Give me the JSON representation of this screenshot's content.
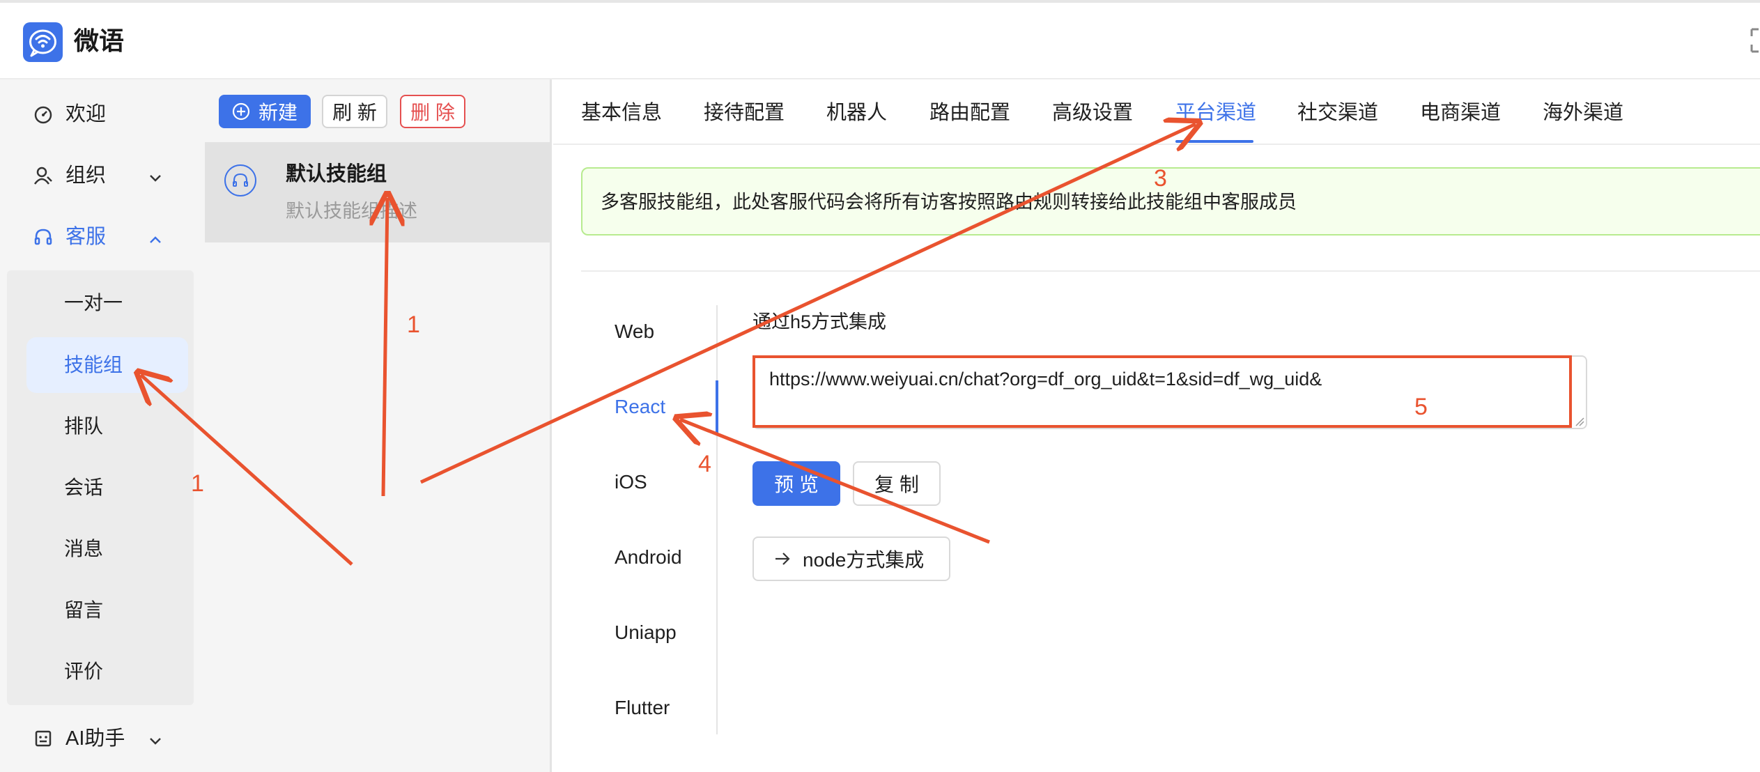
{
  "app": {
    "title": "微语",
    "logo_icon": "chat-bubble-wifi-icon",
    "brand_color": "#3d72e8"
  },
  "sidebar": {
    "items": [
      {
        "label": "欢迎",
        "icon": "dashboard-gauge-icon"
      },
      {
        "label": "组织",
        "icon": "user-group-icon",
        "chevron": "chevron-down-icon"
      },
      {
        "label": "客服",
        "icon": "headset-icon",
        "chevron": "chevron-up-icon",
        "active": true
      },
      {
        "label": "AI助手",
        "icon": "robot-icon",
        "chevron": "chevron-down-icon"
      }
    ],
    "submenu": [
      "一对一",
      "技能组",
      "排队",
      "会话",
      "消息",
      "留言",
      "评价"
    ],
    "submenu_active": "技能组"
  },
  "list_panel": {
    "new_label": "新建",
    "refresh_label": "刷 新",
    "delete_label": "删 除",
    "group": {
      "name": "默认技能组",
      "desc": "默认技能组描述"
    }
  },
  "tabs": [
    "基本信息",
    "接待配置",
    "机器人",
    "路由配置",
    "高级设置",
    "平台渠道",
    "社交渠道",
    "电商渠道",
    "海外渠道"
  ],
  "active_tab": "平台渠道",
  "alert_text": "多客服技能组，此处客服代码会将所有访客按照路由规则转接给此技能组中客服成员",
  "vtabs": [
    "Web",
    "React",
    "iOS",
    "Android",
    "Uniapp",
    "Flutter"
  ],
  "active_vtab": "React",
  "section_title": "通过h5方式集成",
  "url_value": "https://www.weiyuai.cn/chat?org=df_org_uid&t=1&sid=df_wg_uid&",
  "preview_label": "预 览",
  "copy_label": "复 制",
  "node_label": "node方式集成",
  "annotations": {
    "n1a": "1",
    "n1b": "1",
    "n3": "3",
    "n4": "4",
    "n5": "5",
    "color": "#e9532f"
  }
}
